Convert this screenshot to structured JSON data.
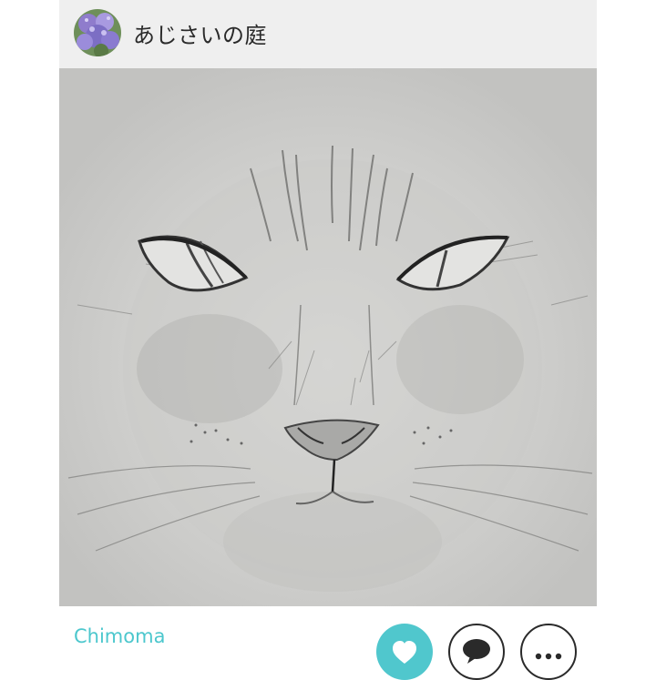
{
  "post": {
    "username": "あじさいの庭",
    "image_subject": "pencil-sketch-cat-face"
  },
  "footer": {
    "author": "Chimoma"
  },
  "actions": {
    "like_icon": "heart-icon",
    "comment_icon": "comment-bubble-icon",
    "more_icon": "ellipsis-icon"
  },
  "colors": {
    "header_bg": "#efefef",
    "accent": "#50c7cd",
    "author_text": "#4cc7cd",
    "image_bg": "#d2d2d0"
  }
}
